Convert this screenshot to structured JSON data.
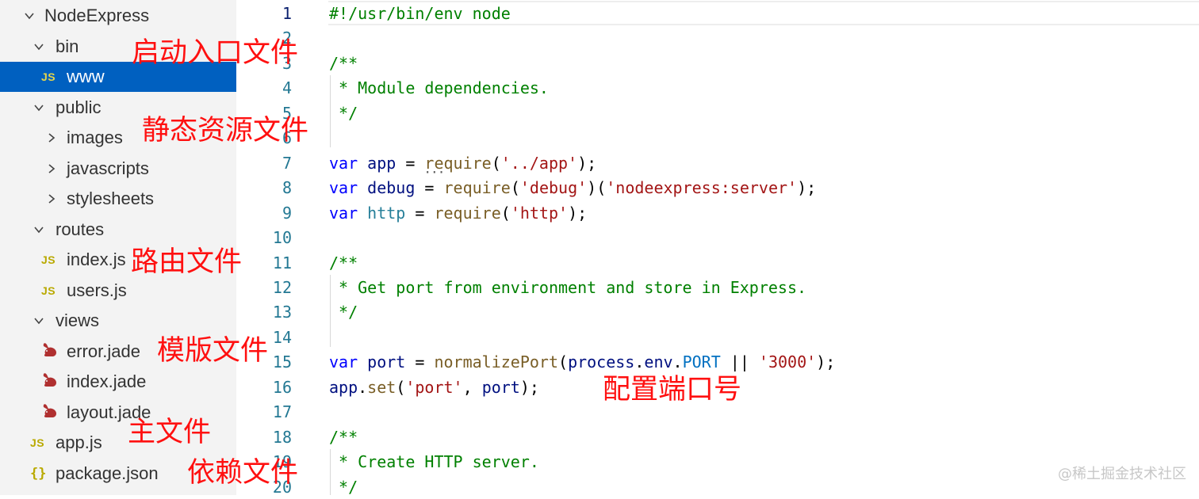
{
  "sidebar": {
    "items": [
      {
        "label": "NodeExpress",
        "kind": "folder-open",
        "icon": "chevron-down-icon"
      },
      {
        "label": "bin",
        "kind": "folder-open",
        "icon": "chevron-down-icon"
      },
      {
        "label": "www",
        "kind": "js-file",
        "icon": "js-file-icon",
        "icon_text": "JS",
        "selected": true
      },
      {
        "label": "public",
        "kind": "folder-open",
        "icon": "chevron-down-icon"
      },
      {
        "label": "images",
        "kind": "folder-closed",
        "icon": "chevron-right-icon"
      },
      {
        "label": "javascripts",
        "kind": "folder-closed",
        "icon": "chevron-right-icon"
      },
      {
        "label": "stylesheets",
        "kind": "folder-closed",
        "icon": "chevron-right-icon"
      },
      {
        "label": "routes",
        "kind": "folder-open",
        "icon": "chevron-down-icon"
      },
      {
        "label": "index.js",
        "kind": "js-file",
        "icon": "js-file-icon",
        "icon_text": "JS"
      },
      {
        "label": "users.js",
        "kind": "js-file",
        "icon": "js-file-icon",
        "icon_text": "JS"
      },
      {
        "label": "views",
        "kind": "folder-open",
        "icon": "chevron-down-icon"
      },
      {
        "label": "error.jade",
        "kind": "jade-file",
        "icon": "jade-rabbit-icon"
      },
      {
        "label": "index.jade",
        "kind": "jade-file",
        "icon": "jade-rabbit-icon"
      },
      {
        "label": "layout.jade",
        "kind": "jade-file",
        "icon": "jade-rabbit-icon"
      },
      {
        "label": "app.js",
        "kind": "js-file",
        "icon": "js-file-icon",
        "icon_text": "JS"
      },
      {
        "label": "package.json",
        "kind": "json-file",
        "icon": "json-braces-icon",
        "icon_text": "{}"
      }
    ]
  },
  "editor": {
    "current_line": 1,
    "lines": [
      {
        "n": "1",
        "tokens": [
          {
            "t": "#!/usr/bin/env node",
            "c": "c-comment"
          }
        ]
      },
      {
        "n": "2",
        "tokens": []
      },
      {
        "n": "3",
        "tokens": [
          {
            "t": "/**",
            "c": "c-comment"
          }
        ]
      },
      {
        "n": "4",
        "tokens": [
          {
            "t": " * Module dependencies.",
            "c": "c-comment"
          }
        ]
      },
      {
        "n": "5",
        "tokens": [
          {
            "t": " */",
            "c": "c-comment"
          }
        ]
      },
      {
        "n": "6",
        "tokens": []
      },
      {
        "n": "7",
        "tokens": [
          {
            "t": "var",
            "c": "c-kw"
          },
          {
            "t": " ",
            "c": "c-plain"
          },
          {
            "t": "app",
            "c": "c-var"
          },
          {
            "t": " = ",
            "c": "c-plain"
          },
          {
            "t": "require",
            "c": "c-fn",
            "squiggle": true
          },
          {
            "t": "(",
            "c": "c-plain"
          },
          {
            "t": "'../app'",
            "c": "c-str"
          },
          {
            "t": ");",
            "c": "c-plain"
          }
        ]
      },
      {
        "n": "8",
        "tokens": [
          {
            "t": "var",
            "c": "c-kw"
          },
          {
            "t": " ",
            "c": "c-plain"
          },
          {
            "t": "debug",
            "c": "c-var"
          },
          {
            "t": " = ",
            "c": "c-plain"
          },
          {
            "t": "require",
            "c": "c-fn"
          },
          {
            "t": "(",
            "c": "c-plain"
          },
          {
            "t": "'debug'",
            "c": "c-str"
          },
          {
            "t": ")(",
            "c": "c-plain"
          },
          {
            "t": "'nodeexpress:server'",
            "c": "c-str"
          },
          {
            "t": ");",
            "c": "c-plain"
          }
        ]
      },
      {
        "n": "9",
        "tokens": [
          {
            "t": "var",
            "c": "c-kw"
          },
          {
            "t": " ",
            "c": "c-plain"
          },
          {
            "t": "http",
            "c": "c-type"
          },
          {
            "t": " = ",
            "c": "c-plain"
          },
          {
            "t": "require",
            "c": "c-fn"
          },
          {
            "t": "(",
            "c": "c-plain"
          },
          {
            "t": "'http'",
            "c": "c-str"
          },
          {
            "t": ");",
            "c": "c-plain"
          }
        ]
      },
      {
        "n": "10",
        "tokens": []
      },
      {
        "n": "11",
        "tokens": [
          {
            "t": "/**",
            "c": "c-comment"
          }
        ]
      },
      {
        "n": "12",
        "tokens": [
          {
            "t": " * Get port from environment and store in Express.",
            "c": "c-comment"
          }
        ]
      },
      {
        "n": "13",
        "tokens": [
          {
            "t": " */",
            "c": "c-comment"
          }
        ]
      },
      {
        "n": "14",
        "tokens": []
      },
      {
        "n": "15",
        "tokens": [
          {
            "t": "var",
            "c": "c-kw"
          },
          {
            "t": " ",
            "c": "c-plain"
          },
          {
            "t": "port",
            "c": "c-var"
          },
          {
            "t": " = ",
            "c": "c-plain"
          },
          {
            "t": "normalizePort",
            "c": "c-fn"
          },
          {
            "t": "(",
            "c": "c-plain"
          },
          {
            "t": "process",
            "c": "c-var"
          },
          {
            "t": ".",
            "c": "c-plain"
          },
          {
            "t": "env",
            "c": "c-var"
          },
          {
            "t": ".",
            "c": "c-plain"
          },
          {
            "t": "PORT",
            "c": "c-const"
          },
          {
            "t": " || ",
            "c": "c-plain"
          },
          {
            "t": "'3000'",
            "c": "c-str"
          },
          {
            "t": ");",
            "c": "c-plain"
          }
        ]
      },
      {
        "n": "16",
        "tokens": [
          {
            "t": "app",
            "c": "c-var"
          },
          {
            "t": ".",
            "c": "c-plain"
          },
          {
            "t": "set",
            "c": "c-fn"
          },
          {
            "t": "(",
            "c": "c-plain"
          },
          {
            "t": "'port'",
            "c": "c-str"
          },
          {
            "t": ", ",
            "c": "c-plain"
          },
          {
            "t": "port",
            "c": "c-var"
          },
          {
            "t": ");",
            "c": "c-plain"
          }
        ]
      },
      {
        "n": "17",
        "tokens": []
      },
      {
        "n": "18",
        "tokens": [
          {
            "t": "/**",
            "c": "c-comment"
          }
        ]
      },
      {
        "n": "19",
        "tokens": [
          {
            "t": " * Create HTTP server.",
            "c": "c-comment"
          }
        ]
      },
      {
        "n": "20",
        "tokens": [
          {
            "t": " */",
            "c": "c-comment"
          }
        ]
      }
    ]
  },
  "annotations": {
    "bin": "启动入口文件",
    "public": "静态资源文件",
    "routes": "路由文件",
    "views": "模版文件",
    "app": "主文件",
    "package": "依赖文件",
    "port": "配置端口号"
  },
  "watermark": "@稀土掘金技术社区",
  "colors": {
    "sidebar_bg": "#f3f3f3",
    "selection": "#0060c0",
    "annotation": "#ff1010",
    "js_icon": "#b9a900",
    "jade_icon": "#b03030"
  }
}
